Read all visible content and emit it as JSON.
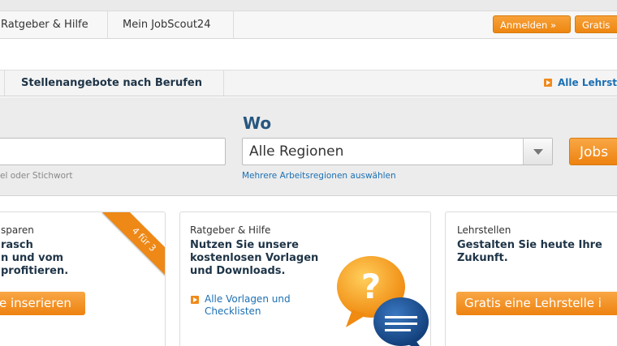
{
  "topnav": {
    "ratgeber": "Ratgeber & Hilfe",
    "mein": "Mein JobScout24",
    "login_button": "Anmelden »",
    "gratis_button": "Gratis"
  },
  "subnav": {
    "berufe_tab": "Stellenangebote nach Berufen",
    "lehrstellen_link": "Alle Lehrste"
  },
  "search": {
    "what_value": "",
    "what_hint": "el oder Stichwort",
    "where_label": "Wo",
    "where_value": "Alle Regionen",
    "where_hint": "Mehrere Arbeitsregionen auswählen",
    "submit_label": "Jobs"
  },
  "cards": [
    {
      "category": "sparen",
      "title": "rasch\nn und vom\nprofitieren.",
      "button": "e inserieren",
      "ribbon": "4 für 3"
    },
    {
      "category": "Ratgeber & Hilfe",
      "title": "Nutzen Sie unsere\nkostenlosen Vorlagen\nund Downloads.",
      "link": "Alle Vorlagen und\nChecklisten",
      "icon": "question-chat-bubbles-icon"
    },
    {
      "category": "Lehrstellen",
      "title": "Gestalten Sie heute Ihre\nZukunft.",
      "button": "Gratis eine Lehrstelle i"
    }
  ],
  "colors": {
    "accent_orange": "#ee8610",
    "link_blue": "#1b6fb3",
    "heading_navy": "#1e3447"
  }
}
